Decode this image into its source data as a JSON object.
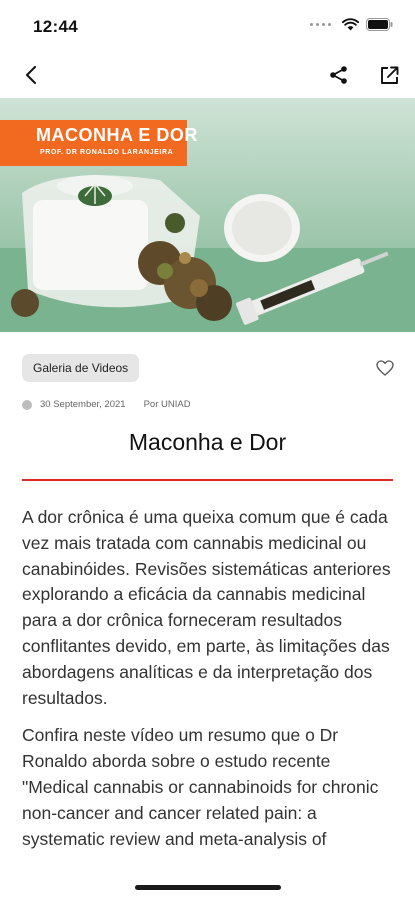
{
  "status": {
    "time": "12:44",
    "icons": [
      "signal-dots-icon",
      "wifi-icon",
      "battery-icon"
    ]
  },
  "nav": {
    "icons": [
      "back-arrow-icon",
      "share-icon",
      "open-external-icon"
    ]
  },
  "hero": {
    "banner_title": "MACONHA E DOR",
    "banner_subtitle": "PROF. DR RONALDO LARANJEIRA",
    "jar_label": "Medical Cannabis",
    "banner_color": "#f26a20"
  },
  "article": {
    "category": "Galeria de Videos",
    "date": "30 September, 2021",
    "author": "Por UNIAD",
    "title": "Maconha e Dor",
    "paragraphs": [
      "A dor crônica é uma queixa comum que é cada vez mais tratada com cannabis medicinal ou canabinóides. Revisões sistemáticas anteriores explorando a eficácia da cannabis medicinal para a dor crônica forneceram resultados conflitantes devido, em parte, às limitações das abordagens analíticas e da interpretação dos resultados.",
      "Confira neste vídeo um resumo que o Dr Ronaldo aborda sobre o estudo recente \"Medical cannabis or cannabinoids for chronic non-cancer and cancer related pain: a systematic review and meta-analysis of"
    ],
    "accent_color": "#e02a2a"
  }
}
